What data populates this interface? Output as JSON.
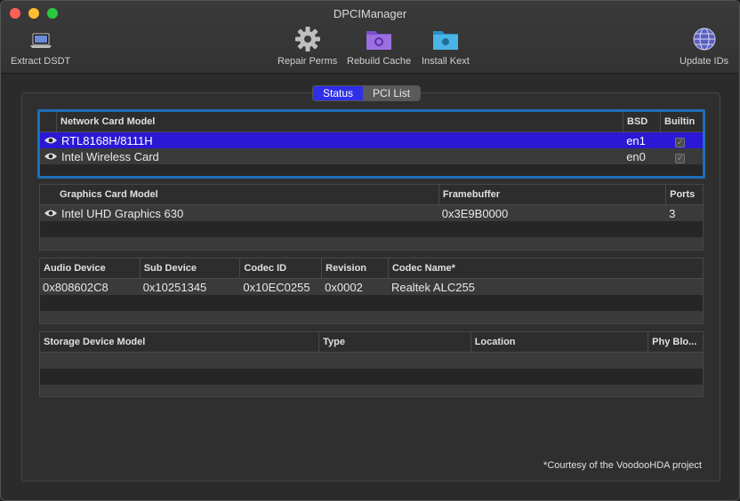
{
  "window": {
    "title": "DPCIManager"
  },
  "toolbar": {
    "extract": "Extract DSDT",
    "repair": "Repair Perms",
    "rebuild": "Rebuild Cache",
    "install": "Install Kext",
    "update": "Update IDs"
  },
  "tabs": [
    "Status",
    "PCI List"
  ],
  "network": {
    "headers": [
      "Network Card Model",
      "BSD",
      "Builtin"
    ],
    "rows": [
      {
        "model": "RTL8168H/8111H",
        "bsd": "en1",
        "builtin": true
      },
      {
        "model": "Intel Wireless Card",
        "bsd": "en0",
        "builtin": true
      }
    ]
  },
  "graphics": {
    "headers": [
      "Graphics Card Model",
      "Framebuffer",
      "Ports"
    ],
    "rows": [
      {
        "model": "Intel UHD Graphics 630",
        "framebuffer": "0x3E9B0000",
        "ports": "3"
      }
    ]
  },
  "audio": {
    "headers": [
      "Audio Device",
      "Sub Device",
      "Codec ID",
      "Revision",
      "Codec Name*"
    ],
    "rows": [
      {
        "device": "0x808602C8",
        "sub": "0x10251345",
        "codec": "0x10EC0255",
        "rev": "0x0002",
        "name": "Realtek ALC255"
      }
    ]
  },
  "storage": {
    "headers": [
      "Storage Device Model",
      "Type",
      "Location",
      "Phy Blo..."
    ]
  },
  "footer": "*Courtesy of the VoodooHDA project"
}
